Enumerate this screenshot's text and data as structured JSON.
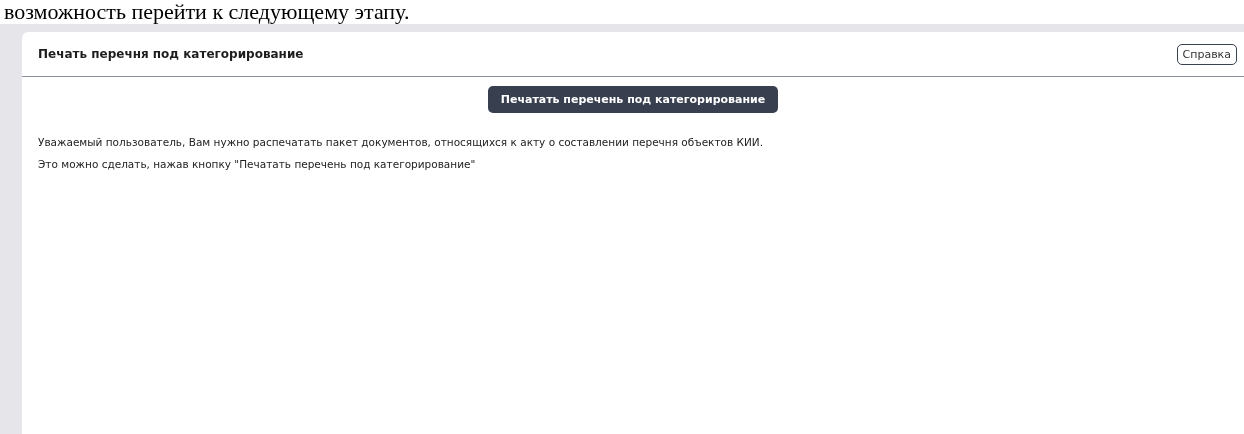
{
  "caption": "возможность перейти к следующему этапу.",
  "panel": {
    "title": "Печать перечня под категорирование",
    "help_button": "Справка",
    "print_button": "Печатать перечень под категорирование",
    "paragraphs": [
      "Уважаемый пользователь, Вам нужно распечатать пакет документов, относящихся к акту о составлении перечня объектов КИИ.",
      "Это можно сделать, нажав кнопку \"Печатать перечень под категорирование\""
    ]
  }
}
